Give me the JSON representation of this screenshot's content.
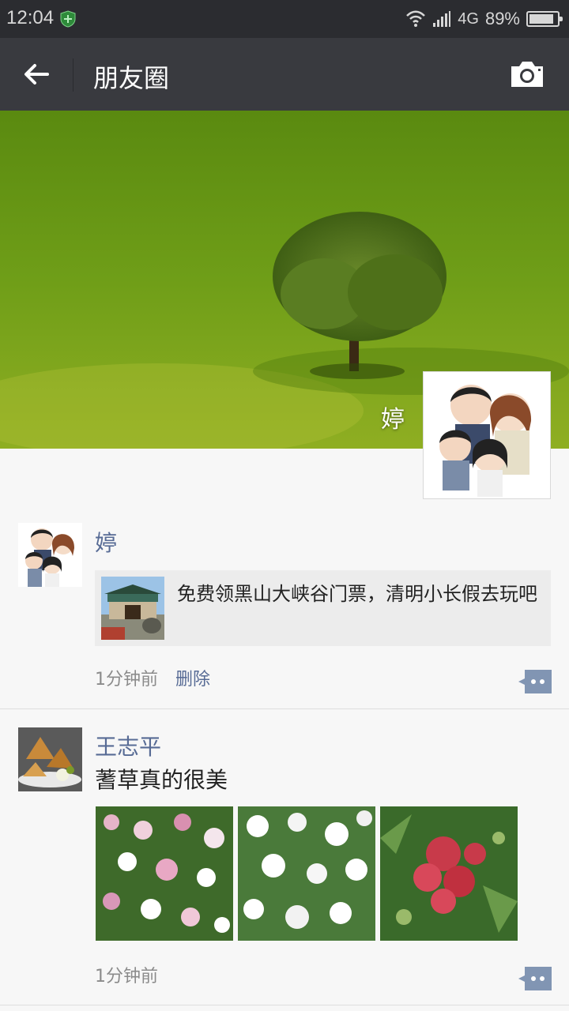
{
  "status_bar": {
    "time": "12:04",
    "network": "4G",
    "battery": "89%",
    "battery_level": 0.89
  },
  "nav": {
    "title": "朋友圈",
    "back_icon": "back-arrow-icon",
    "camera_icon": "camera-icon"
  },
  "cover": {
    "user_name": "婷"
  },
  "posts": [
    {
      "user": "婷",
      "link_title": "免费领黑山大峡谷门票，清明小长假去玩吧",
      "time": "1分钟前",
      "delete_label": "删除"
    },
    {
      "user": "王志平",
      "text": "蓍草真的很美",
      "time": "1分钟前"
    }
  ],
  "colors": {
    "nav_bg": "#393a3f",
    "status_bg": "#2b2c30",
    "link_blue": "#576b95",
    "page_bg": "#f7f7f7"
  }
}
